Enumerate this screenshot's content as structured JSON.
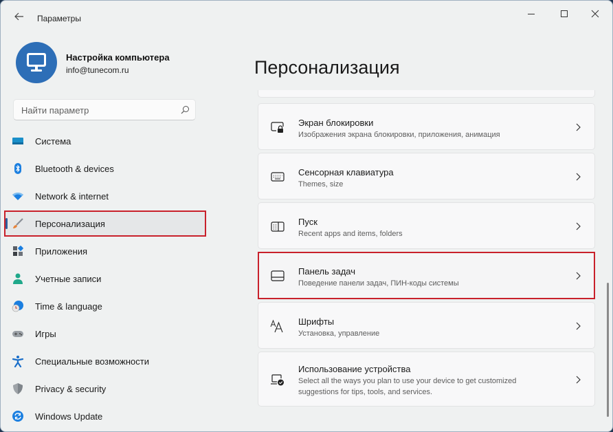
{
  "window": {
    "title": "Параметры",
    "controls": {
      "minimize": "minimize",
      "maximize": "maximize",
      "close": "close"
    }
  },
  "profile": {
    "name": "Настройка компьютера",
    "email": "info@tunecom.ru",
    "avatar_icon": "monitor-icon",
    "avatar_color": "#2d6eb7"
  },
  "search": {
    "placeholder": "Найти параметр",
    "icon": "search-icon"
  },
  "sidebar": {
    "selected_index": 3,
    "accent": "#2d5d9c",
    "highlight_color": "#c8202a",
    "items": [
      {
        "label": "Система",
        "icon": "system-display-icon"
      },
      {
        "label": "Bluetooth & devices",
        "icon": "bluetooth-icon"
      },
      {
        "label": "Network & internet",
        "icon": "wifi-icon"
      },
      {
        "label": "Персонализация",
        "icon": "paintbrush-icon"
      },
      {
        "label": "Приложения",
        "icon": "apps-icon"
      },
      {
        "label": "Учетные записи",
        "icon": "user-icon"
      },
      {
        "label": "Time & language",
        "icon": "clock-globe-icon"
      },
      {
        "label": "Игры",
        "icon": "gamepad-icon"
      },
      {
        "label": "Специальные возможности",
        "icon": "accessibility-icon"
      },
      {
        "label": "Privacy & security",
        "icon": "shield-icon"
      },
      {
        "label": "Windows Update",
        "icon": "windows-update-icon"
      }
    ]
  },
  "main": {
    "title": "Персонализация",
    "cards": [
      {
        "title": "Экран блокировки",
        "subtitle": "Изображения экрана блокировки, приложения, анимация",
        "icon": "lock-screen-icon"
      },
      {
        "title": "Сенсорная клавиатура",
        "subtitle": "Themes, size",
        "icon": "keyboard-icon"
      },
      {
        "title": "Пуск",
        "subtitle": "Recent apps and items, folders",
        "icon": "start-menu-icon"
      },
      {
        "title": "Панель задач",
        "subtitle": "Поведение панели задач, ПИН-коды системы",
        "icon": "taskbar-icon",
        "highlighted": true
      },
      {
        "title": "Шрифты",
        "subtitle": "Установка, управление",
        "icon": "fonts-icon"
      },
      {
        "title": "Использование устройства",
        "subtitle": "Select all the ways you plan to use your device to get customized suggestions for tips, tools, and services.",
        "icon": "device-usage-icon"
      }
    ]
  }
}
